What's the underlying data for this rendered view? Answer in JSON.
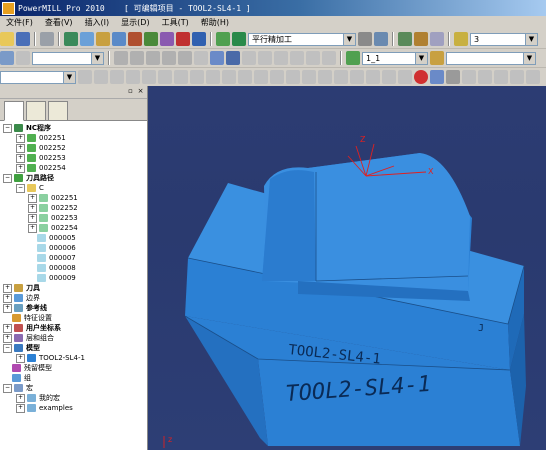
{
  "window": {
    "title": "PowerMILL Pro 2010    [ 可编辑项目 - TOOL2-SL4-1 ]"
  },
  "menu": [
    "文件(F)",
    "查看(V)",
    "插入(I)",
    "显示(D)",
    "工具(T)",
    "帮助(H)"
  ],
  "toolbar1": {
    "strategy_combo": "平行精加工",
    "count_combo": "3"
  },
  "toolbar2": {
    "layer_combo": "1_1"
  },
  "tree": {
    "nc_programs": "NC程序",
    "nc_items": [
      "002251",
      "002252",
      "002253",
      "002254"
    ],
    "toolpaths": "刀具路径",
    "toolpath_group": "C",
    "toolpath_items": [
      "002251",
      "002252",
      "002253",
      "002254",
      "000005",
      "000006",
      "000007",
      "000008",
      "000009"
    ],
    "tools": "刀具",
    "boundaries": "边界",
    "patterns": "参考线",
    "feature_sets": "特征设置",
    "workplanes": "用户坐标系",
    "levels": "层和组合",
    "models": "模型",
    "model_item": "TOOL2-SL4-1",
    "stock_models": "残留模型",
    "groups": "组",
    "macros": "宏",
    "macro_items": [
      "我的宏",
      "examples"
    ]
  },
  "viewport": {
    "model_label_top": "TOOL2-SL4-1",
    "model_label_front": "TOOL2-SL4-1",
    "corner_j": "J",
    "axis_x": "X",
    "axis_z": "Z",
    "corner_axis": "z",
    "model_color": "#2b80d4"
  }
}
